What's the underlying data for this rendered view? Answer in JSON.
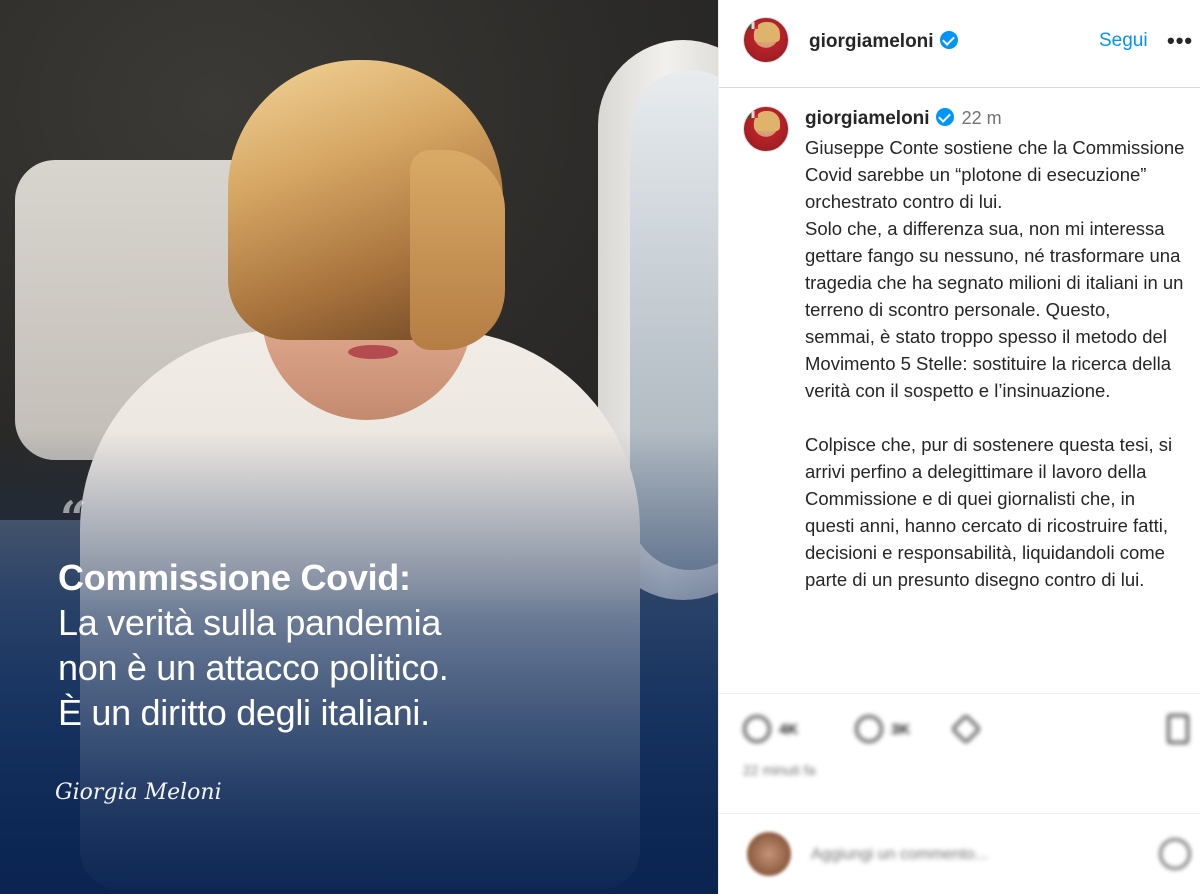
{
  "post_image": {
    "quote_mark": "“",
    "headline_line1": "Commissione Covid:",
    "headline_line2": "La verità sulla pandemia",
    "headline_line3": "non è un attacco politico.",
    "headline_line4": "È un diritto degli italiani.",
    "signature": "Giorgia Meloni"
  },
  "header": {
    "username": "giorgiameloni",
    "follow_label": "Segui",
    "more_label": "•••"
  },
  "caption": {
    "username": "giorgiameloni",
    "time": "22 m",
    "text": "Giuseppe Conte sostiene che la Commissione Covid sarebbe un “plotone di esecuzione” orchestrato contro di lui.\nSolo che, a differenza sua, non mi interessa gettare fango su nessuno, né trasformare una tragedia che ha segnato milioni di italiani in un terreno di scontro personale. Questo, semmai, è stato troppo spesso il metodo del Movimento 5 Stelle: sostituire la ricerca della verità con il sospetto e l’insinuazione.\n\nColpisce che, pur di sostenere questa tesi, si arrivi perfino a delegittimare il lavoro della Commissione e di quei giornalisti che, in questi anni, hanno cercato di ricostruire fatti, decisioni e responsabilità, liquidandoli come parte di un presunto disegno contro di lui."
  },
  "actions": {
    "like_count": "4K",
    "comment_count": "3K",
    "date": "22 minuti fa"
  },
  "comment": {
    "placeholder": "Aggiungi un commento..."
  },
  "colors": {
    "link_blue": "#0095f6",
    "text": "#262626",
    "muted": "#737373"
  }
}
